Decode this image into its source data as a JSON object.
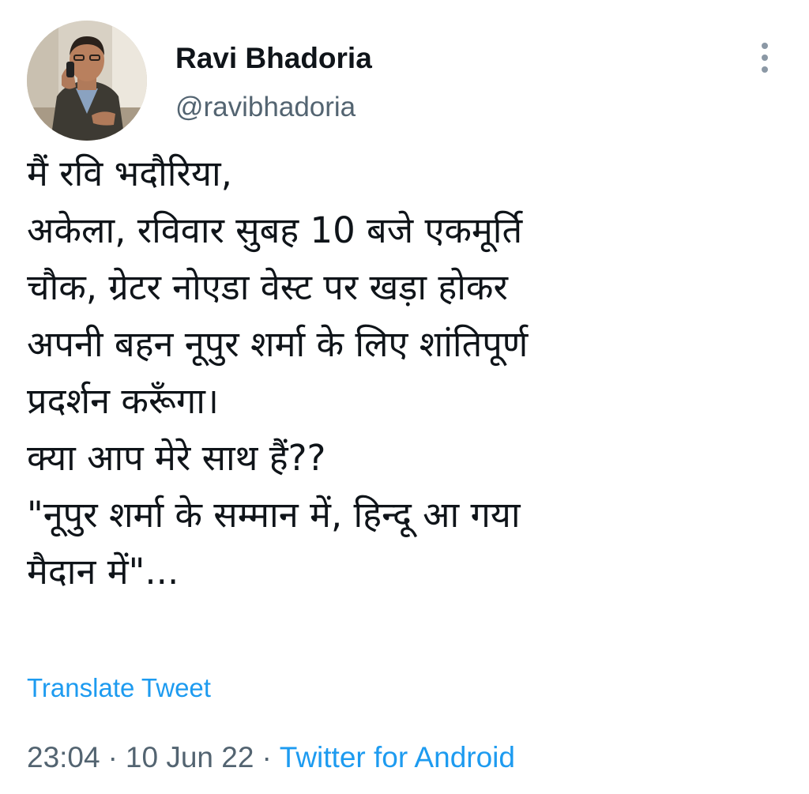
{
  "author": {
    "display_name": "Ravi Bhadoria",
    "handle": "@ravibhadoria"
  },
  "tweet": {
    "lines": [
      "मैं रवि भदौरिया,",
      "अकेला, रविवार सुबह 10 बजे एकमूर्ति",
      "चौक, ग्रेटर नोएडा वेस्ट पर खड़ा होकर",
      "अपनी बहन नूपुर शर्मा के लिए शांतिपूर्ण",
      "प्रदर्शन करूँगा।",
      "क्या आप मेरे साथ हैं??",
      "\"नूपुर शर्मा के सम्मान में, हिन्दू आ गया",
      "मैदान में\"..."
    ],
    "translate_label": "Translate Tweet"
  },
  "meta": {
    "time": "23:04",
    "separator": "·",
    "date": "10 Jun 22",
    "source": "Twitter for Android"
  },
  "icons": {
    "more": "more-vertical-icon",
    "avatar": "profile-photo"
  },
  "colors": {
    "link": "#1d9bf0",
    "secondary_text": "#536471",
    "primary_text": "#0f1419",
    "background": "#ffffff"
  }
}
